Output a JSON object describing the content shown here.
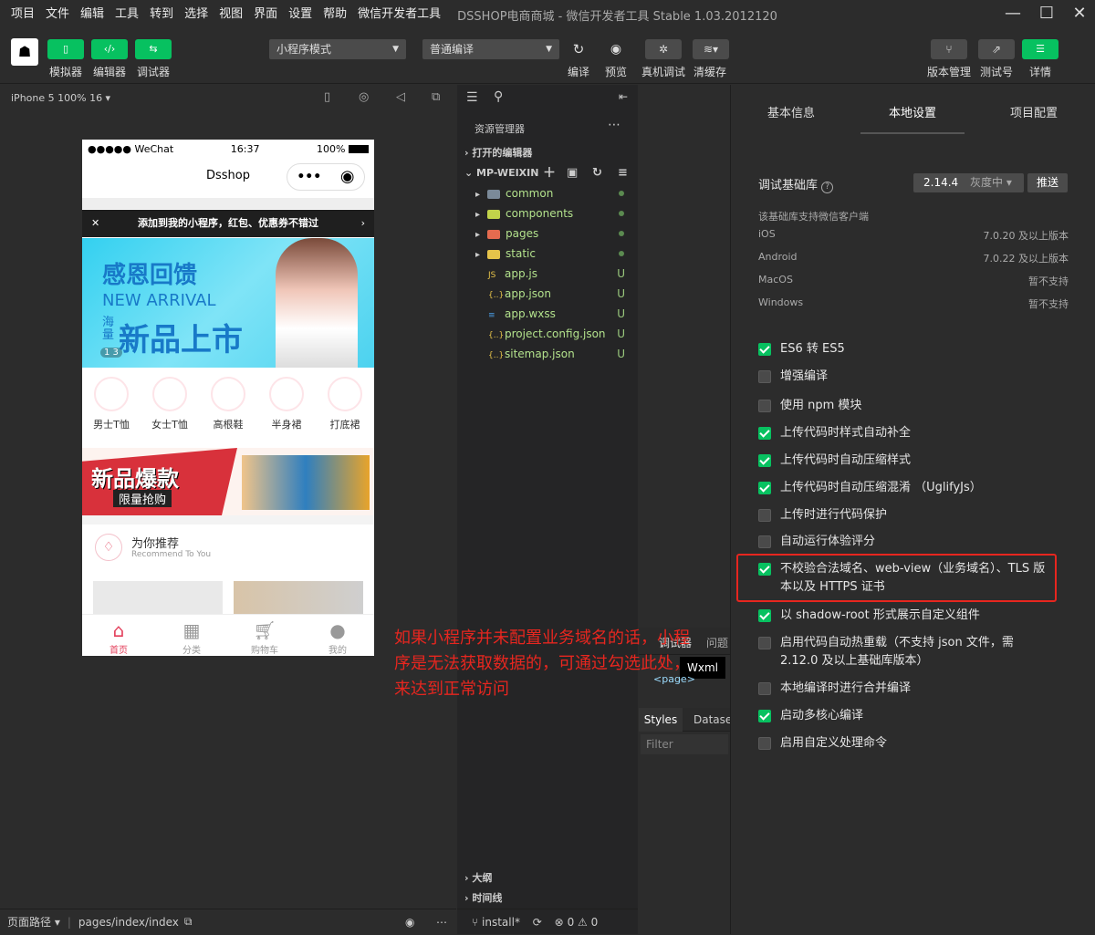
{
  "menubar": {
    "items": [
      "项目",
      "文件",
      "编辑",
      "工具",
      "转到",
      "选择",
      "视图",
      "界面",
      "设置",
      "帮助",
      "微信开发者工具"
    ],
    "title": "DSSHOP电商商城 - 微信开发者工具 Stable 1.03.2012120"
  },
  "toolbar": {
    "simulator_label": "模拟器",
    "editor_label": "编辑器",
    "debugger_label": "调试器",
    "mode_select": "小程序模式",
    "compile_select": "普通编译",
    "compile_label": "编译",
    "preview_label": "预览",
    "remote_debug_label": "真机调试",
    "clear_cache_label": "清缓存",
    "version_label": "版本管理",
    "test_label": "测试号",
    "details_label": "详情"
  },
  "simulator": {
    "device": "iPhone 5 100% 16 ▾",
    "status_carrier": "●●●●● WeChat",
    "status_time": "16:37",
    "status_battery": "100%",
    "nav_title": "Dsshop",
    "tip": "添加到我的小程序，红包、优惠券不错过",
    "banner_title": "感恩回馈",
    "banner_sub": "NEW ARRIVAL",
    "banner_main": "新品上市",
    "banner_side": "海量",
    "banner_indicator": "1 3",
    "categories": [
      "男士T恤",
      "女士T恤",
      "高根鞋",
      "半身裙",
      "打底裙"
    ],
    "promo_title": "新品爆款",
    "promo_sub": "限量抢购",
    "rec_title": "为你推荐",
    "rec_sub": "Recommend To You",
    "tabs": [
      "首页",
      "分类",
      "购物车",
      "我的"
    ],
    "footer_path_label": "页面路径 ▾",
    "footer_path": "pages/index/index"
  },
  "explorer": {
    "header": "资源管理器",
    "open_editors": "打开的编辑器",
    "project": "MP-WEIXIN",
    "folders": [
      {
        "name": "common",
        "color": "#7b8a99"
      },
      {
        "name": "components",
        "color": "#c1d34a"
      },
      {
        "name": "pages",
        "color": "#e56b4f"
      },
      {
        "name": "static",
        "color": "#e6c34a"
      }
    ],
    "files": [
      {
        "icon": "JS",
        "name": "app.js",
        "status": "U",
        "color": "#e6c34a"
      },
      {
        "icon": "{..}",
        "name": "app.json",
        "status": "U",
        "color": "#e6c34a"
      },
      {
        "icon": "≡",
        "name": "app.wxss",
        "status": "U",
        "color": "#4a9ee6"
      },
      {
        "icon": "{..}",
        "name": "project.config.json",
        "status": "U",
        "color": "#e6c34a"
      },
      {
        "icon": "{..}",
        "name": "sitemap.json",
        "status": "U",
        "color": "#e6c34a"
      }
    ],
    "outline": "大纲",
    "timeline": "时间线",
    "status_branch": "install*",
    "status_errors": "0",
    "status_warnings": "0"
  },
  "devtools": {
    "tab_debugger": "调试器",
    "tab_issues": "问题",
    "tooltip": "Wxml",
    "page_tag": "<page>",
    "styles": "Styles",
    "dataset": "Dataset",
    "filter": "Filter"
  },
  "settings": {
    "tabs": [
      "基本信息",
      "本地设置",
      "项目配置"
    ],
    "lib_label": "调试基础库",
    "lib_version": "2.14.4",
    "lib_status": "灰度中 ▾",
    "push": "推送",
    "support_note": "该基础库支持微信客户端",
    "os": [
      {
        "name": "iOS",
        "value": "7.0.20 及以上版本"
      },
      {
        "name": "Android",
        "value": "7.0.22 及以上版本"
      },
      {
        "name": "MacOS",
        "value": "暂不支持"
      },
      {
        "name": "Windows",
        "value": "暂不支持"
      }
    ],
    "options": [
      {
        "label": "ES6 转 ES5",
        "checked": true
      },
      {
        "label": "增强编译",
        "checked": false
      },
      {
        "label": "使用 npm 模块",
        "checked": false
      },
      {
        "label": "上传代码时样式自动补全",
        "checked": true
      },
      {
        "label": "上传代码时自动压缩样式",
        "checked": true
      },
      {
        "label": "上传代码时自动压缩混淆 （UglifyJs）",
        "checked": true
      },
      {
        "label": "上传时进行代码保护",
        "checked": false
      },
      {
        "label": "自动运行体验评分",
        "checked": false
      },
      {
        "label": "不校验合法域名、web-view（业务域名）、TLS 版本以及 HTTPS 证书",
        "checked": true
      },
      {
        "label": "以 shadow-root 形式展示自定义组件",
        "checked": true
      },
      {
        "label": "启用代码自动热重载（不支持 json 文件，需 2.12.0 及以上基础库版本）",
        "checked": false
      },
      {
        "label": "本地编译时进行合并编译",
        "checked": false
      },
      {
        "label": "启动多核心编译",
        "checked": true
      },
      {
        "label": "启用自定义处理命令",
        "checked": false
      }
    ]
  },
  "annotation": "如果小程序并未配置业务域名的话，小程序是无法获取数据的，可通过勾选此处，来达到正常访问",
  "colors": {
    "accent": "#07c160",
    "highlight": "#e7261f"
  }
}
